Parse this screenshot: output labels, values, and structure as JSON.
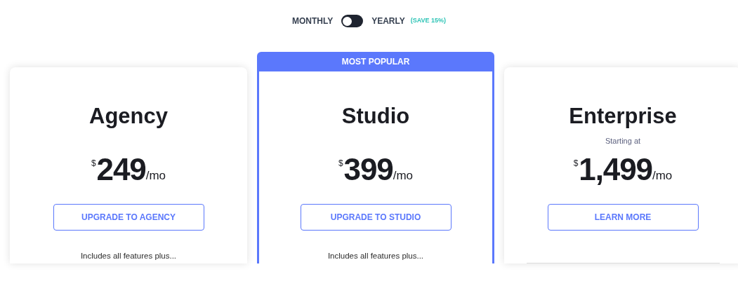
{
  "billing_toggle": {
    "monthly_label": "MONTHLY",
    "yearly_label": "YEARLY",
    "save_badge": "(SAVE 15%)",
    "on": false
  },
  "plans": [
    {
      "name": "Agency",
      "highlighted": false,
      "currency": "$",
      "price": "249",
      "period": "/mo",
      "button": "UPGRADE TO AGENCY",
      "includes": "Includes all features plus..."
    },
    {
      "name": "Studio",
      "highlighted": true,
      "badge": "MOST POPULAR",
      "currency": "$",
      "price": "399",
      "period": "/mo",
      "button": "UPGRADE TO STUDIO",
      "includes": "Includes all features plus..."
    },
    {
      "name": "Enterprise",
      "highlighted": false,
      "note": "Starting at",
      "currency": "$",
      "price": "1,499",
      "period": "/mo",
      "button": "LEARN MORE"
    }
  ]
}
